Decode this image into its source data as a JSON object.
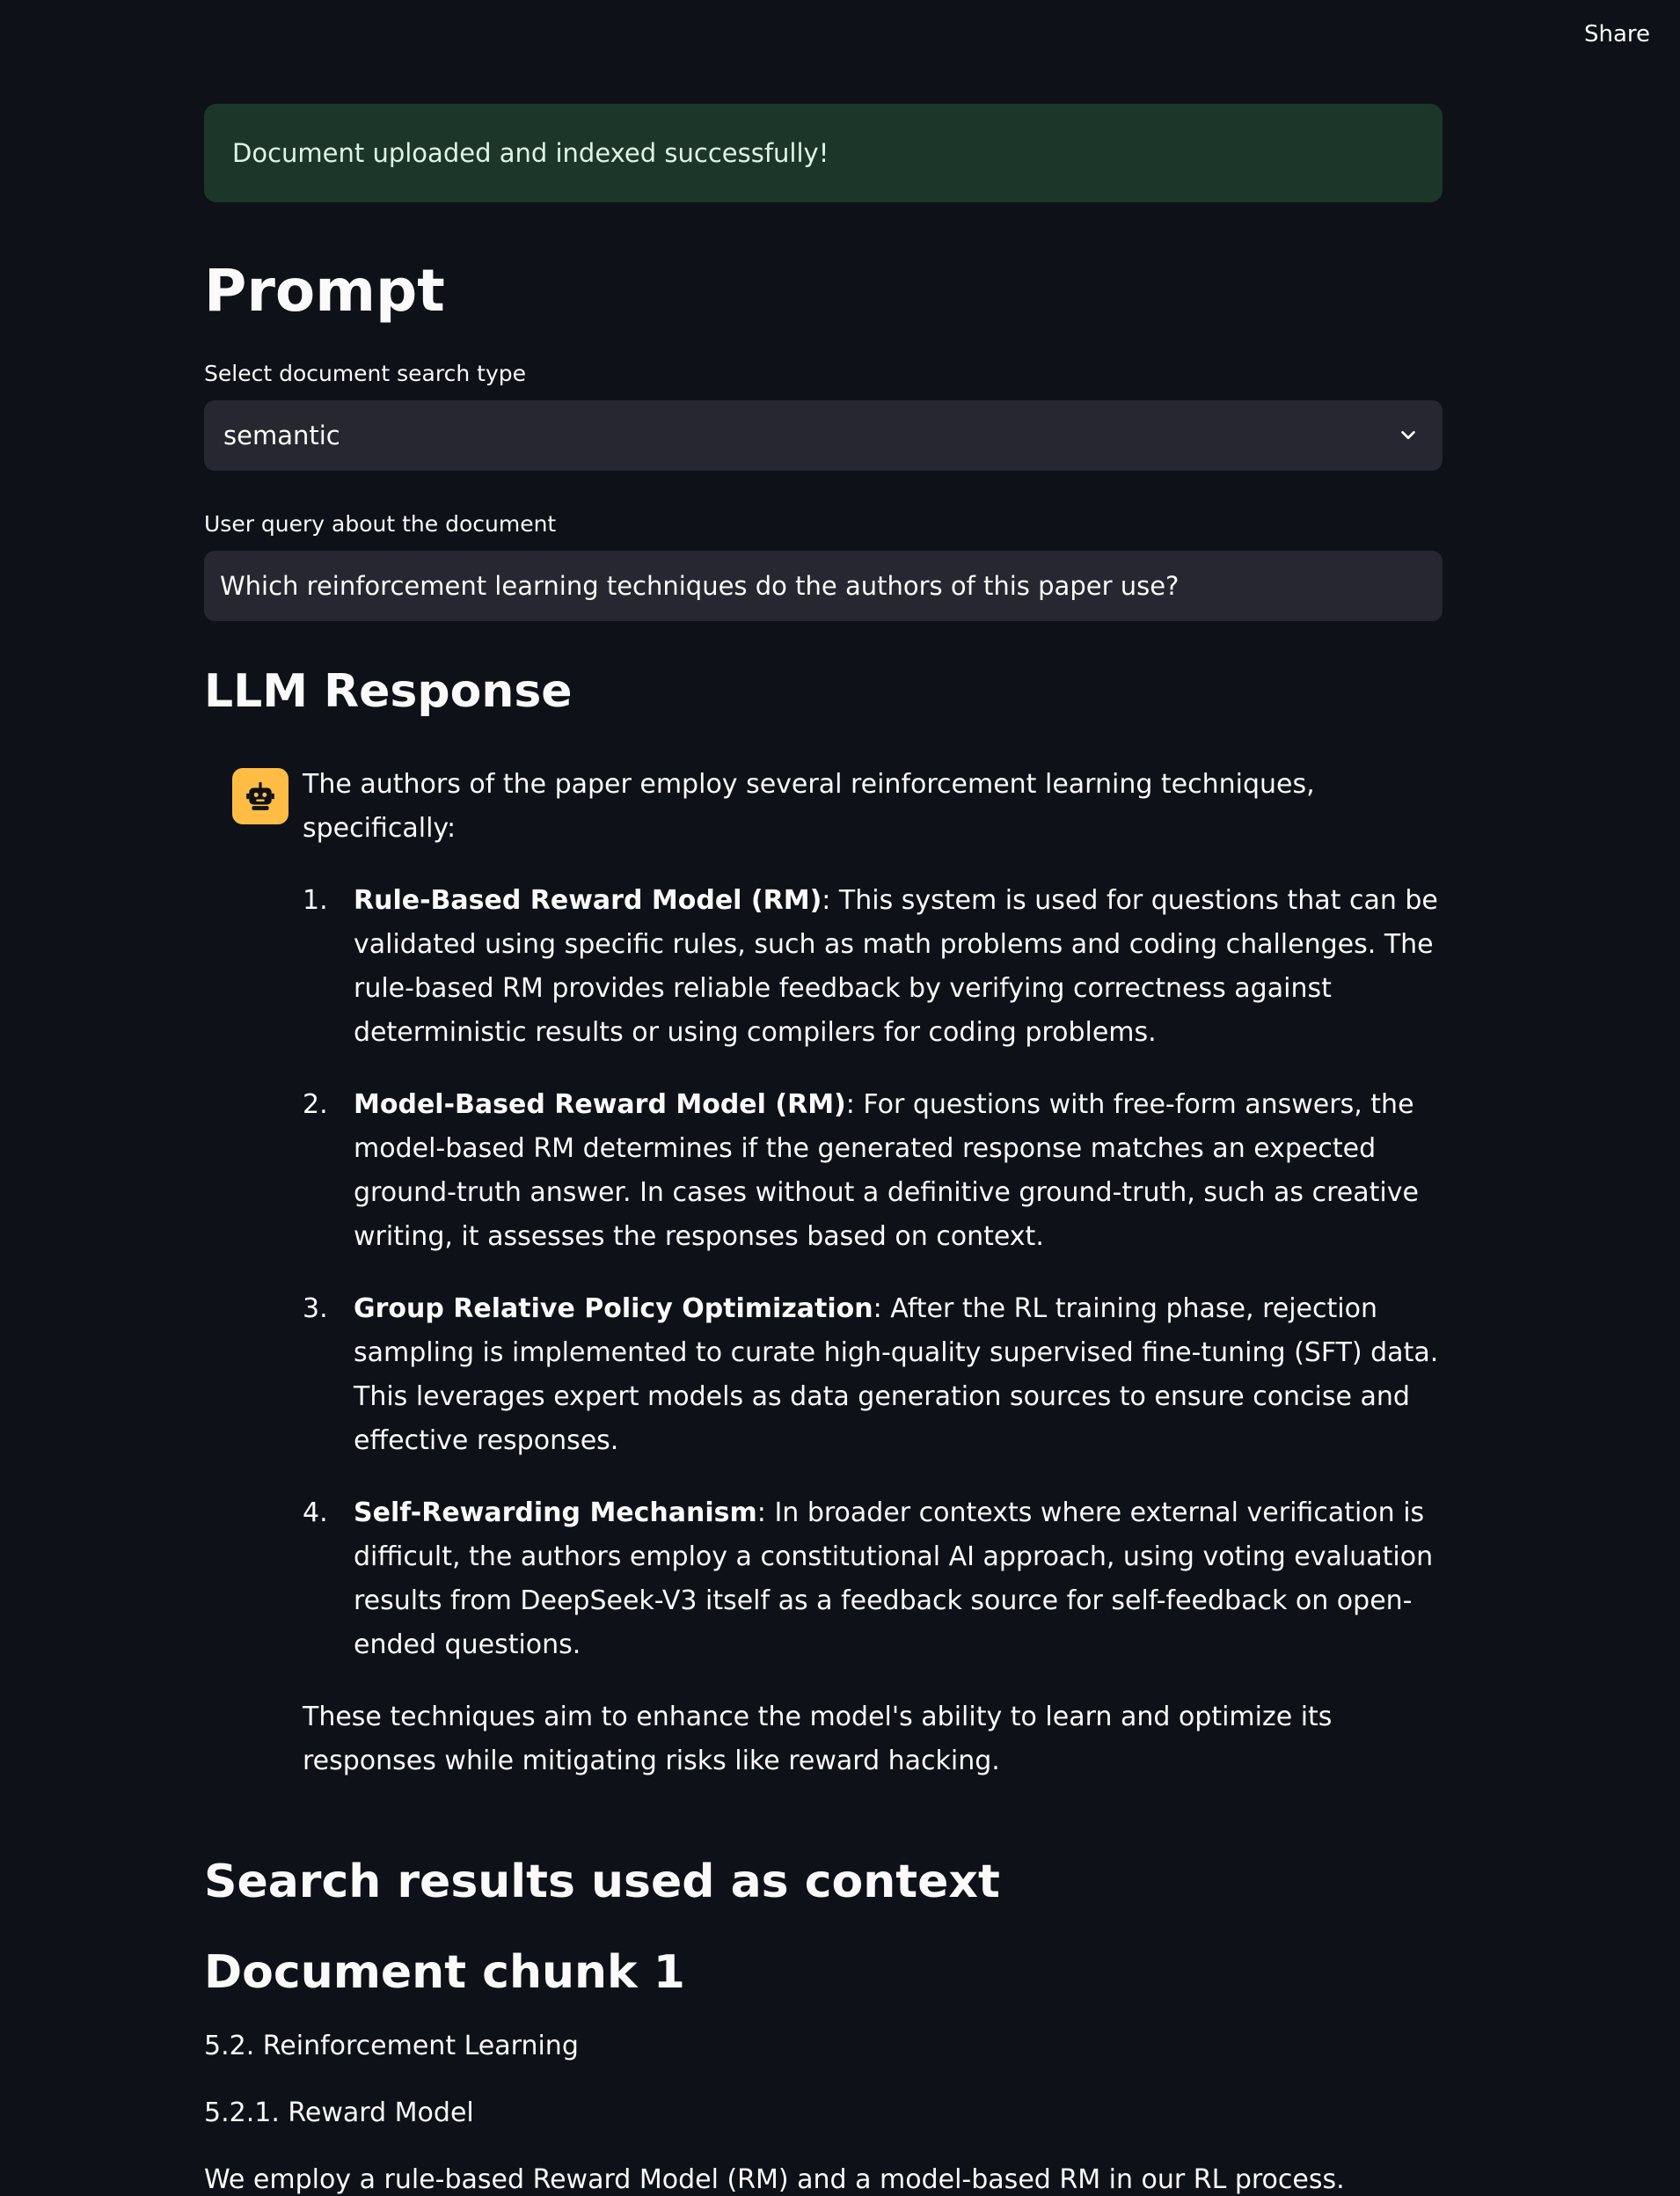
{
  "header": {
    "share_label": "Share"
  },
  "alert": {
    "success_text": "Document uploaded and indexed successfully!",
    "color": "#1c3728"
  },
  "prompt": {
    "title": "Prompt",
    "search_type_label": "Select document search type",
    "search_type_value": "semantic",
    "query_label": "User query about the document",
    "query_value": "Which reinforcement learning techniques do the authors of this paper use?"
  },
  "llm_response": {
    "title": "LLM Response",
    "avatar_icon": "robot-icon",
    "avatar_color": "#ffbd45",
    "intro": "The authors of the paper employ several reinforcement learning techniques, specifically:",
    "items": [
      {
        "number": "1.",
        "term": "Rule-Based Reward Model (RM)",
        "text": ": This system is used for questions that can be validated using specific rules, such as math problems and coding challenges. The rule-based RM provides reliable feedback by verifying correctness against deterministic results or using compilers for coding problems."
      },
      {
        "number": "2.",
        "term": "Model-Based Reward Model (RM)",
        "text": ": For questions with free-form answers, the model-based RM determines if the generated response matches an expected ground-truth answer. In cases without a definitive ground-truth, such as creative writing, it assesses the responses based on context."
      },
      {
        "number": "3.",
        "term": "Group Relative Policy Optimization",
        "text": ": After the RL training phase, rejection sampling is implemented to curate high-quality supervised fine-tuning (SFT) data. This leverages expert models as data generation sources to ensure concise and effective responses."
      },
      {
        "number": "4.",
        "term": "Self-Rewarding Mechanism",
        "text": ": In broader contexts where external verification is difficult, the authors employ a constitutional AI approach, using voting evaluation results from DeepSeek-V3 itself as a feedback source for self-feedback on open-ended questions."
      }
    ],
    "outro": "These techniques aim to enhance the model's ability to learn and optimize its responses while mitigating risks like reward hacking."
  },
  "search_results": {
    "title": "Search results used as context",
    "chunk_title": "Document chunk 1",
    "lines": [
      "5.2. Reinforcement Learning",
      "5.2.1. Reward Model",
      "We employ a rule-based Reward Model (RM) and a model-based RM in our RL process."
    ]
  }
}
